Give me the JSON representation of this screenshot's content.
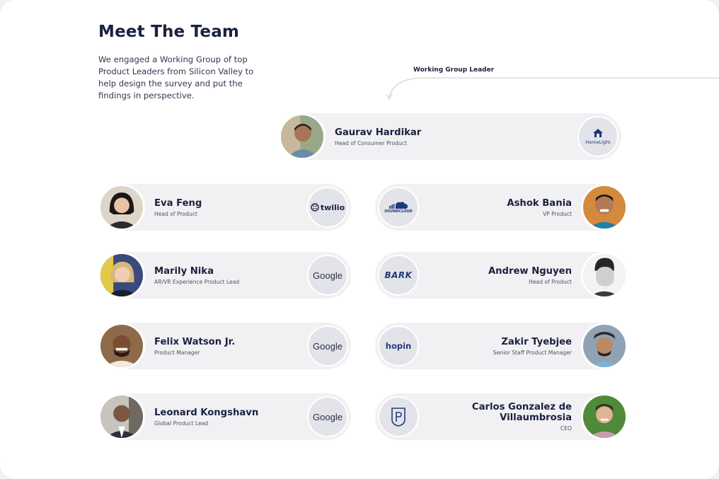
{
  "header": {
    "title": "Meet The Team",
    "intro": "We engaged a Working Group of top Product Leaders from Silicon Valley to help design the survey and put the findings in perspective."
  },
  "leader_label": "Working Group Leader",
  "leader": {
    "name": "Gaurav Hardikar",
    "role": "Head of Consumer Product",
    "company": "HomeLight",
    "logo_icon": "house-icon"
  },
  "left_column": [
    {
      "name": "Eva Feng",
      "role": "Head of Product",
      "company": "twilio"
    },
    {
      "name": "Marily Nika",
      "role": "AR/VR Experience Product Lead",
      "company": "Google"
    },
    {
      "name": "Felix Watson Jr.",
      "role": "Product Manager",
      "company": "Google"
    },
    {
      "name": "Leonard Kongshavn",
      "role": "Global Product Lead",
      "company": "Google"
    }
  ],
  "right_column": [
    {
      "name": "Ashok Bania",
      "role": "VP Product",
      "company": "SOUNDCLOUD"
    },
    {
      "name": "Andrew Nguyen",
      "role": "Head of Product",
      "company": "BARK"
    },
    {
      "name": "Zakir Tyebjee",
      "role": "Senior Staff Product Manager",
      "company": "hopin"
    },
    {
      "name": "Carlos Gonzalez de Villaumbrosia",
      "role": "CEO",
      "company": "Product School"
    }
  ],
  "colors": {
    "navy": "#1b2140",
    "row_bg": "#f1f1f4",
    "logo_bg": "#e3e3ea"
  }
}
